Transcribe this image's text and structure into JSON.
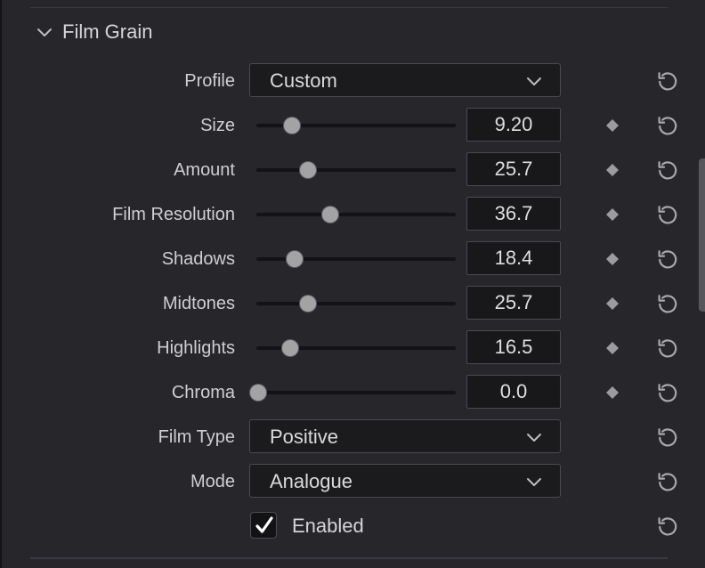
{
  "section": {
    "title": "Film Grain",
    "expanded": true
  },
  "profile": {
    "label": "Profile",
    "value": "Custom"
  },
  "sliders": [
    {
      "label": "Size",
      "value": "9.20",
      "position": 0.18
    },
    {
      "label": "Amount",
      "value": "25.7",
      "position": 0.26
    },
    {
      "label": "Film Resolution",
      "value": "36.7",
      "position": 0.37
    },
    {
      "label": "Shadows",
      "value": "18.4",
      "position": 0.19
    },
    {
      "label": "Midtones",
      "value": "25.7",
      "position": 0.26
    },
    {
      "label": "Highlights",
      "value": "16.5",
      "position": 0.17
    },
    {
      "label": "Chroma",
      "value": "0.0",
      "position": 0.01
    }
  ],
  "film_type": {
    "label": "Film Type",
    "value": "Positive"
  },
  "mode": {
    "label": "Mode",
    "value": "Analogue"
  },
  "enabled": {
    "label": "Enabled",
    "checked": true
  },
  "icons": {
    "collapse": "chevron-down-icon",
    "dropdown": "chevron-down-icon",
    "keyframe": "keyframe-diamond-icon",
    "reset": "reset-icon",
    "check": "checkmark-icon"
  },
  "colors": {
    "background": "#26262b",
    "field": "#18181a",
    "text": "#cfcfd2",
    "thumb": "#a3a3a6"
  }
}
